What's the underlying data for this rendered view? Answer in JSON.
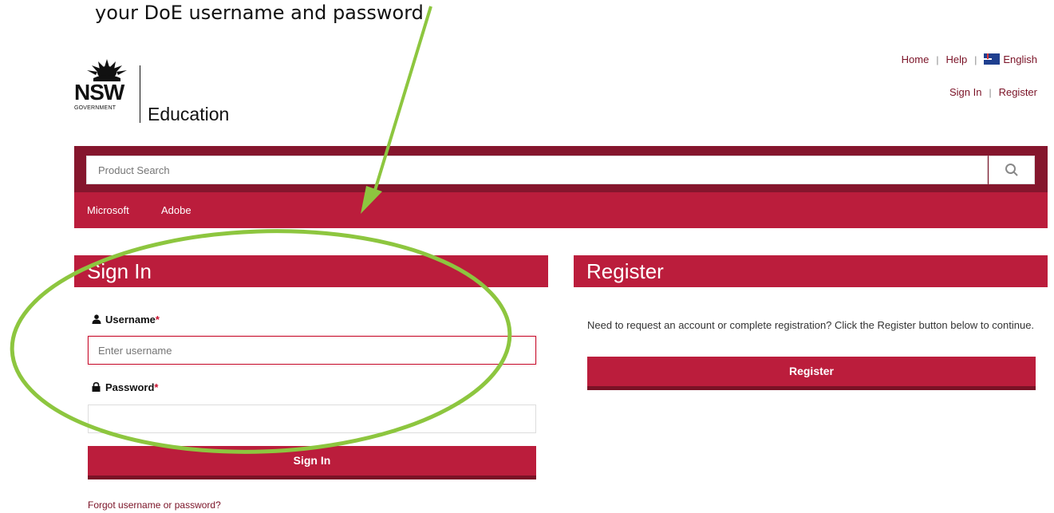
{
  "annotation": {
    "text": "your DoE username and password"
  },
  "brand": {
    "logo_text": "NSW",
    "government": "GOVERNMENT",
    "name": "Education"
  },
  "toplinks": {
    "home": "Home",
    "help": "Help",
    "language": "English",
    "sign_in": "Sign In",
    "register": "Register"
  },
  "search": {
    "placeholder": "Product Search"
  },
  "nav": {
    "items": [
      "Microsoft",
      "Adobe"
    ]
  },
  "signin": {
    "title": "Sign In",
    "username_label": "Username",
    "username_placeholder": "Enter username",
    "password_label": "Password",
    "required_mark": "*",
    "button": "Sign In",
    "forgot": "Forgot username or password?"
  },
  "register": {
    "title": "Register",
    "text": "Need to request an account or complete registration? Click the Register button below to continue.",
    "button": "Register"
  },
  "colors": {
    "brand_red": "#bb1d3c",
    "brand_dark": "#85162d",
    "annotation_green": "#8dc63f"
  },
  "icons": {
    "search": "magnifier-icon",
    "user": "user-icon",
    "lock": "lock-icon",
    "flag": "australia-flag-icon"
  }
}
